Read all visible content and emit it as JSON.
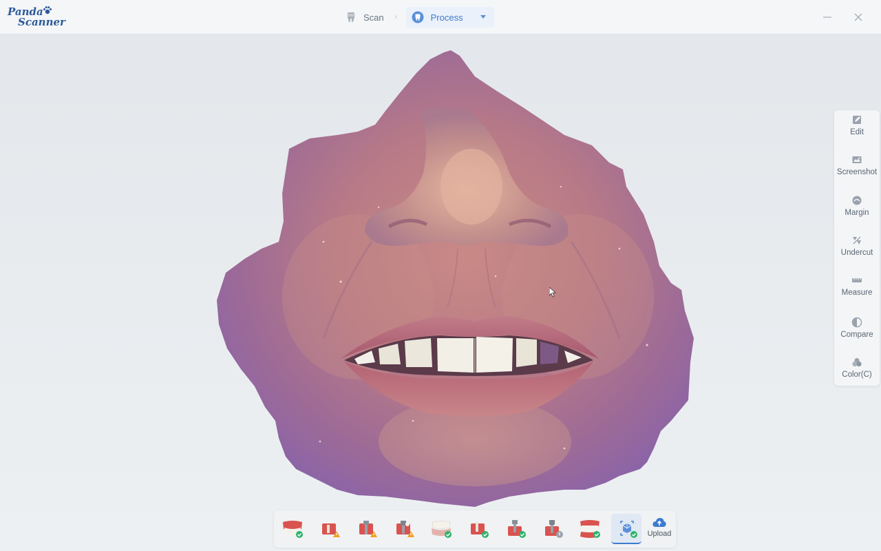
{
  "app": {
    "logo_line1": "Panda",
    "logo_line2": "Scanner"
  },
  "steps": {
    "scan_label": "Scan",
    "process_label": "Process"
  },
  "side_tools": [
    {
      "label": "Edit",
      "icon": "edit-icon"
    },
    {
      "label": "Screenshot",
      "icon": "screenshot-icon"
    },
    {
      "label": "Margin",
      "icon": "margin-icon"
    },
    {
      "label": "Undercut",
      "icon": "undercut-icon"
    },
    {
      "label": "Measure",
      "icon": "ruler-icon"
    },
    {
      "label": "Compare",
      "icon": "compare-icon"
    },
    {
      "label": "Color(C)",
      "icon": "color-icon"
    }
  ],
  "bottom_bar": {
    "items": [
      {
        "icon": "upper-jaw-status-ok-icon",
        "status": "ok"
      },
      {
        "icon": "upper-abutment-warning-icon",
        "status": "warning"
      },
      {
        "icon": "upper-scanbody-warning-icon",
        "status": "warning"
      },
      {
        "icon": "upper-implant-warning-icon",
        "status": "warning"
      },
      {
        "icon": "lower-jaw-status-ok-icon",
        "status": "ok"
      },
      {
        "icon": "lower-abutment-ok-icon",
        "status": "ok"
      },
      {
        "icon": "lower-scanbody-ok-icon",
        "status": "ok"
      },
      {
        "icon": "lower-implant-info-icon",
        "status": "info"
      },
      {
        "icon": "bite-status-ok-icon",
        "status": "ok"
      },
      {
        "icon": "face-scan-status-ok-icon",
        "status": "ok",
        "selected": true
      }
    ],
    "upload_label": "Upload"
  },
  "colors": {
    "accent": "#3d7ad0",
    "brand": "#2d5a99",
    "ok": "#2fb36b",
    "warning": "#f0a020"
  }
}
